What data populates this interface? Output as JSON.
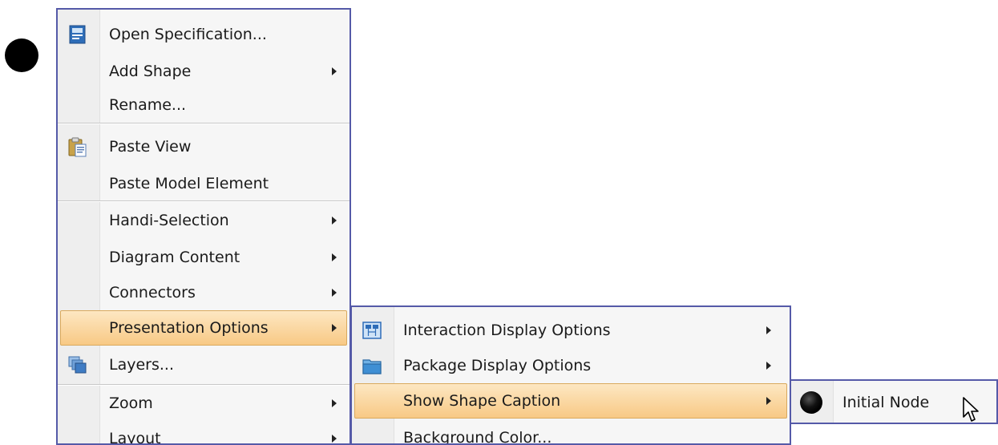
{
  "main_menu": {
    "items": [
      {
        "label": "Open Specification...",
        "icon": "open-specification-icon",
        "submenu": false
      },
      {
        "label": "Add Shape",
        "icon": "",
        "submenu": true
      },
      {
        "label": "Rename...",
        "icon": "",
        "submenu": false
      },
      {
        "label": "Paste View",
        "icon": "paste-clipboard-icon",
        "submenu": false
      },
      {
        "label": "Paste Model Element",
        "icon": "",
        "submenu": false
      },
      {
        "label": "Handi-Selection",
        "icon": "",
        "submenu": true
      },
      {
        "label": "Diagram Content",
        "icon": "",
        "submenu": true
      },
      {
        "label": "Connectors",
        "icon": "",
        "submenu": true
      },
      {
        "label": "Presentation Options",
        "icon": "",
        "submenu": true,
        "highlighted": true
      },
      {
        "label": "Layers...",
        "icon": "layers-icon",
        "submenu": false
      },
      {
        "label": "Zoom",
        "icon": "",
        "submenu": true
      },
      {
        "label": "Layout",
        "icon": "",
        "submenu": true
      }
    ]
  },
  "presentation_menu": {
    "items": [
      {
        "label": "Interaction Display Options",
        "icon": "interaction-display-icon",
        "submenu": true
      },
      {
        "label": "Package Display Options",
        "icon": "package-folder-icon",
        "submenu": true
      },
      {
        "label": "Show Shape Caption",
        "icon": "",
        "submenu": true,
        "highlighted": true
      },
      {
        "label": "Background Color...",
        "icon": "",
        "submenu": false
      }
    ]
  },
  "caption_menu": {
    "items": [
      {
        "label": "Initial Node",
        "icon": "initial-node-icon",
        "submenu": false
      }
    ]
  },
  "colors": {
    "menu_border": "#555aa8",
    "menu_background": "#f6f6f6",
    "highlight_top": "#fde7c2",
    "highlight_bottom": "#f8c985",
    "highlight_border": "#d9a95d"
  }
}
